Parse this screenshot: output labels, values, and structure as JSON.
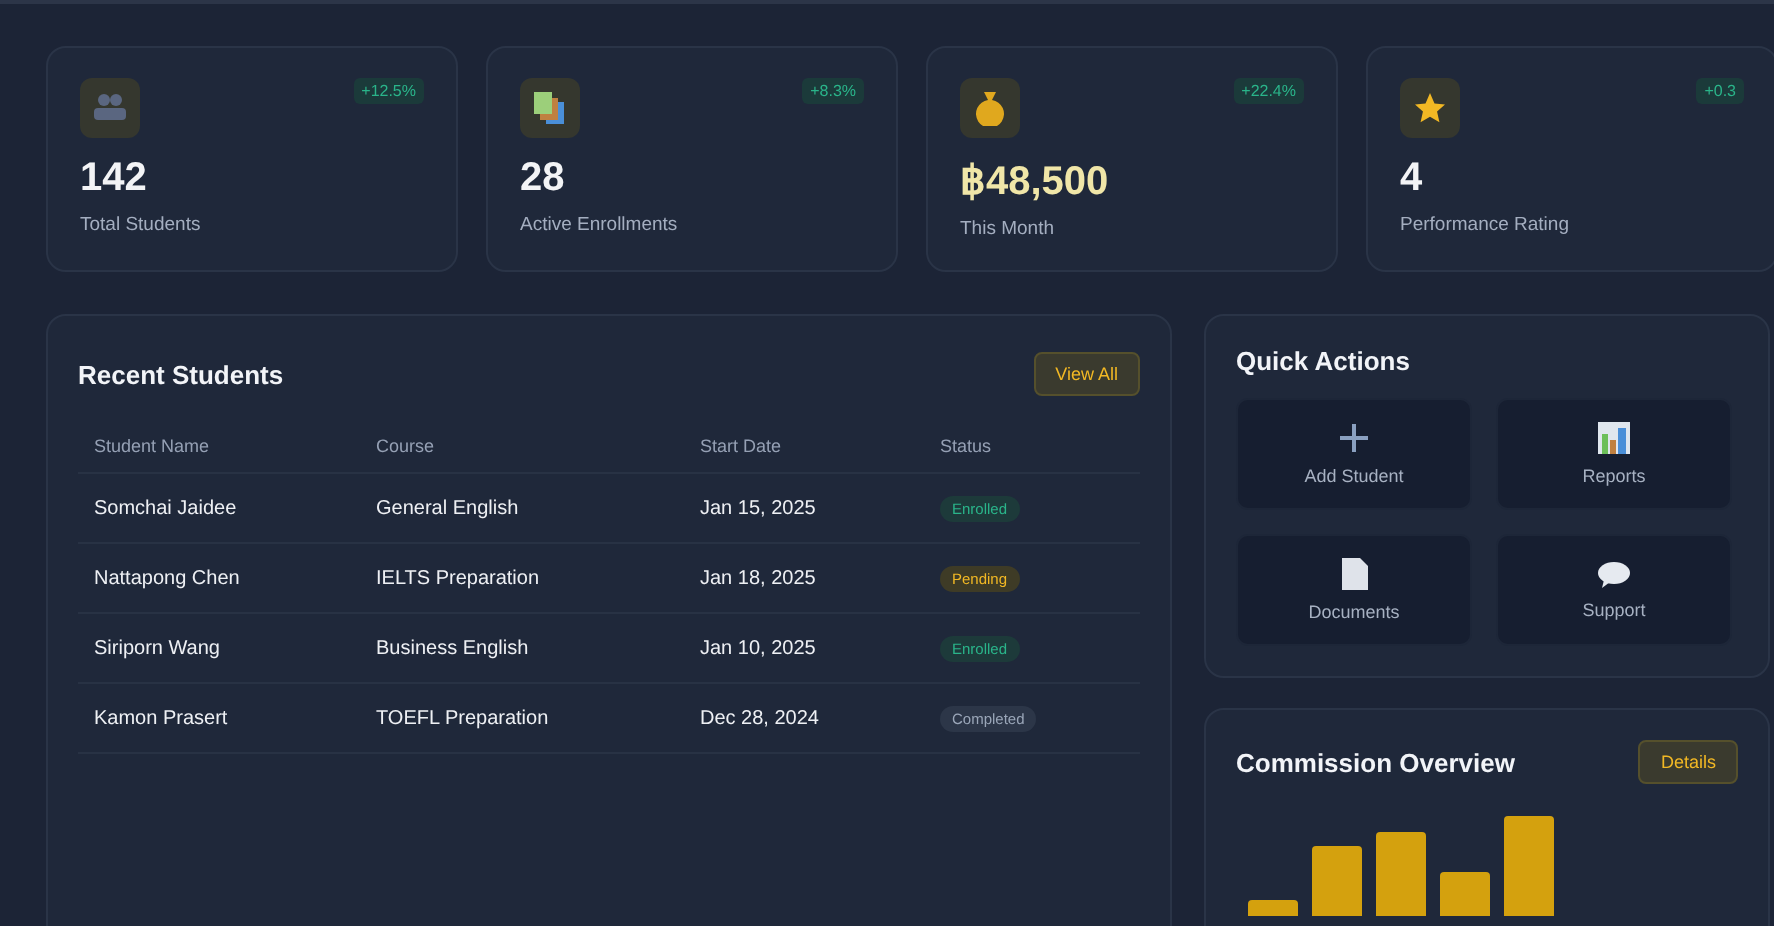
{
  "stats": [
    {
      "kind": "people",
      "change": "+12.5%",
      "value": "142",
      "label": "Total Students"
    },
    {
      "kind": "books",
      "change": "+8.3%",
      "value": "28",
      "label": "Active Enrollments"
    },
    {
      "kind": "moneybag",
      "change": "+22.4%",
      "value": "฿48,500",
      "label": "This Month"
    },
    {
      "kind": "star",
      "change": "+0.3",
      "value": "4",
      "label": "Performance Rating"
    }
  ],
  "recent_students": {
    "title": "Recent Students",
    "button": "View All",
    "columns": [
      "Student Name",
      "Course",
      "Start Date",
      "Status"
    ],
    "rows": [
      {
        "name": "Somchai Jaidee",
        "course": "General English",
        "date": "Jan 15, 2025",
        "status": "Enrolled",
        "kind": "enrolled"
      },
      {
        "name": "Nattapong Chen",
        "course": "IELTS Preparation",
        "date": "Jan 18, 2025",
        "status": "Pending",
        "kind": "pending"
      },
      {
        "name": "Siriporn Wang",
        "course": "Business English",
        "date": "Jan 10, 2025",
        "status": "Enrolled",
        "kind": "enrolled"
      },
      {
        "name": "Kamon Prasert",
        "course": "TOEFL Preparation",
        "date": "Dec 28, 2024",
        "status": "Completed",
        "kind": "completed"
      }
    ]
  },
  "quick_actions": {
    "title": "Quick Actions",
    "items": [
      {
        "kind": "plus",
        "label": "Add Student"
      },
      {
        "kind": "chart",
        "label": "Reports"
      },
      {
        "kind": "document",
        "label": "Documents"
      },
      {
        "kind": "speech",
        "label": "Support"
      }
    ]
  },
  "commission": {
    "title": "Commission Overview",
    "button": "Details"
  }
}
